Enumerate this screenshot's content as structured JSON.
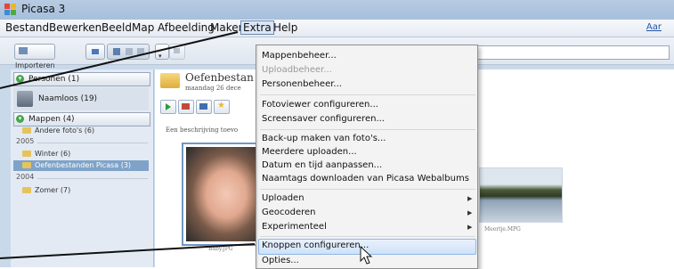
{
  "window": {
    "title": "Picasa 3"
  },
  "menubar": {
    "items": [
      "Bestand",
      "Bewerken",
      "Beeld",
      "Map",
      "Afbeelding",
      "Maken",
      "Extra",
      "Help"
    ],
    "right_link": "Aar"
  },
  "toolbar": {
    "import_label": "Importeren"
  },
  "sidebar": {
    "people_header": "Personen (1)",
    "unnamed_person": "Naamloos (19)",
    "folders_header": "Mappen (4)",
    "other_photos": "Andere foto's (6)",
    "year_2005": "2005",
    "winter": "Winter (6)",
    "oefen": "Oefenbestanden Picasa (3)",
    "year_2004": "2004",
    "zomer": "Zomer (7)"
  },
  "album": {
    "title": "Oefenbestan",
    "date": "maandag 26 dece",
    "description": "Een beschrijving toevo",
    "photo_caption": "Baby.JPG",
    "landscape_caption": "Meertje.MPG"
  },
  "extra_menu": {
    "items": [
      "Mappenbeheer...",
      "Uploadbeheer...",
      "Personenbeheer...",
      "Fotoviewer configureren...",
      "Screensaver configureren...",
      "Back-up maken van foto's...",
      "Meerdere uploaden...",
      "Datum en tijd aanpassen...",
      "Naamtags downloaden van Picasa Webalbums",
      "Uploaden",
      "Geocoderen",
      "Experimenteel",
      "Knoppen configureren...",
      "Opties..."
    ],
    "disabled_item": "Uploadbeheer...",
    "highlighted_item": "Knoppen configureren..."
  },
  "colors": {
    "highlight": "#cfe2f8",
    "selected_folder": "#7fa3c8"
  }
}
